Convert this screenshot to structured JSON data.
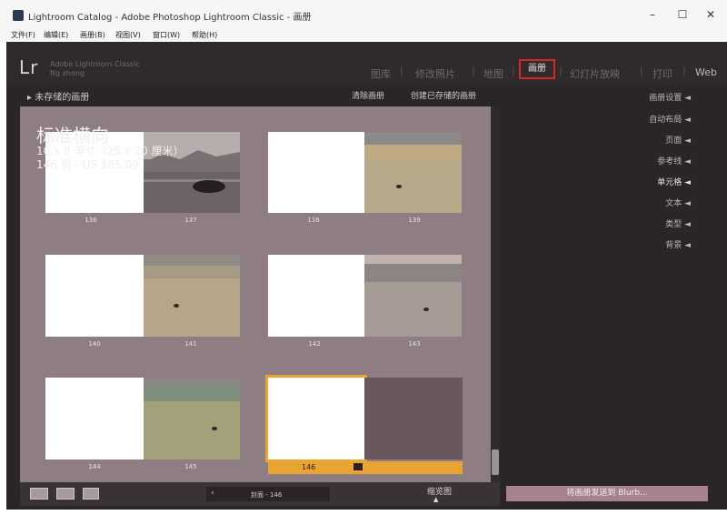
{
  "window": {
    "title": "Lightroom Catalog - Adobe Photoshop Lightroom Classic - 画册",
    "minimize": "–",
    "maximize": "☐",
    "close": "✕"
  },
  "menu": [
    "文件(F)",
    "编辑(E)",
    "画册(B)",
    "视图(V)",
    "窗口(W)",
    "帮助(H)"
  ],
  "identity": {
    "logo": "Lr",
    "line1": "Adobe Lightroom Classic",
    "line2": "Ng zhong"
  },
  "modules": [
    "图库",
    "修改照片",
    "地图",
    "画册",
    "幻灯片放映",
    "打印",
    "Web"
  ],
  "active_module": "画册",
  "header": {
    "unsaved": "未存储的画册",
    "clear": "清除画册",
    "create_saved": "创建已存储的画册"
  },
  "book": {
    "title": "标准横向",
    "size": "10 x 8 英寸（25 x 20 厘米）",
    "price": "146 页 - US $85.09"
  },
  "spreads": [
    {
      "left": "136",
      "right": "137"
    },
    {
      "left": "138",
      "right": "139"
    },
    {
      "left": "140",
      "right": "141"
    },
    {
      "left": "142",
      "right": "143"
    },
    {
      "left": "144",
      "right": "145"
    },
    {
      "left": "146",
      "right": ""
    }
  ],
  "right_panel": [
    {
      "label": "画册设置 ◄",
      "active": false
    },
    {
      "label": "自动布局 ◄",
      "active": false
    },
    {
      "label": "页面 ◄",
      "active": false
    },
    {
      "label": "参考线 ◄",
      "active": false
    },
    {
      "label": "单元格 ◄",
      "active": true
    },
    {
      "label": "文本 ◄",
      "active": false
    },
    {
      "label": "类型 ◄",
      "active": false
    },
    {
      "label": "背景 ◄",
      "active": false
    }
  ],
  "toolbar": {
    "nav_prev": "‹",
    "nav_text": "封面 - 146",
    "thumbs_label": "缩览图",
    "thumbs_caret": "▲",
    "send_blurb": "将画册发送到 Blurb..."
  }
}
